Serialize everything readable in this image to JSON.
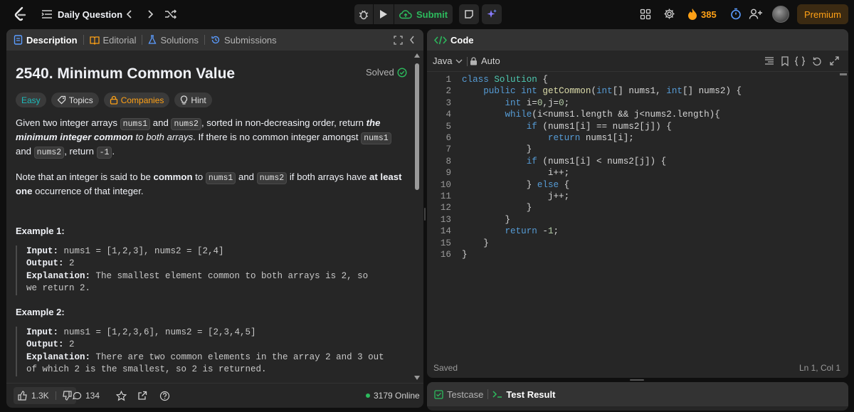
{
  "topbar": {
    "problem_list_label": "Daily Question",
    "submit_label": "Submit",
    "streak_count": "385",
    "premium_label": "Premium"
  },
  "left_panel": {
    "tabs": [
      {
        "label": "Description"
      },
      {
        "label": "Editorial"
      },
      {
        "label": "Solutions"
      },
      {
        "label": "Submissions"
      }
    ],
    "title": "2540. Minimum Common Value",
    "status": "Solved",
    "tags": {
      "difficulty": "Easy",
      "topics": "Topics",
      "companies": "Companies",
      "hint": "Hint"
    },
    "description": {
      "p1_a": "Given two integer arrays ",
      "p1_b": "nums1",
      "p1_c": " and ",
      "p1_d": "nums2",
      "p1_e": ", sorted in non-decreasing order, return ",
      "p1_f": "the minimum integer common",
      "p1_g": " to both arrays",
      "p1_h": ". If there is no common integer amongst ",
      "p1_i": "nums1",
      "p1_j": " and ",
      "p1_k": "nums2",
      "p1_l": ", return ",
      "p1_m": "-1",
      "p1_n": ".",
      "p2_a": "Note that an integer is said to be ",
      "p2_b": "common",
      "p2_c": " to ",
      "p2_d": "nums1",
      "p2_e": " and ",
      "p2_f": "nums2",
      "p2_g": " if both arrays have ",
      "p2_h": "at least one",
      "p2_i": " occurrence of that integer."
    },
    "examples": [
      {
        "title": "Example 1:",
        "input_label": "Input:",
        "input_value": " nums1 = [1,2,3], nums2 = [2,4]",
        "output_label": "Output:",
        "output_value": " 2",
        "explanation_label": "Explanation:",
        "explanation_value": " The smallest element common to both arrays is 2, so we return 2."
      },
      {
        "title": "Example 2:",
        "input_label": "Input:",
        "input_value": " nums1 = [1,2,3,6], nums2 = [2,3,4,5]",
        "output_label": "Output:",
        "output_value": " 2",
        "explanation_label": "Explanation:",
        "explanation_value": " There are two common elements in the array 2 and 3 out of which 2 is the smallest, so 2 is returned."
      }
    ],
    "footer": {
      "likes": "1.3K",
      "comments": "134",
      "online": "3179 Online"
    }
  },
  "code_panel": {
    "title": "Code",
    "language": "Java",
    "mode": "Auto",
    "line_numbers": [
      "1",
      "2",
      "3",
      "4",
      "5",
      "6",
      "7",
      "8",
      "9",
      "10",
      "11",
      "12",
      "13",
      "14",
      "15",
      "16"
    ],
    "saved_label": "Saved",
    "cursor_position": "Ln 1, Col 1"
  },
  "bottom_panel": {
    "testcase_label": "Testcase",
    "test_result_label": "Test Result"
  },
  "colors": {
    "accent_green": "#2cbb5d",
    "streak_orange": "#ffa116",
    "premium_text": "#ffa116",
    "link_blue": "#569cd6"
  }
}
